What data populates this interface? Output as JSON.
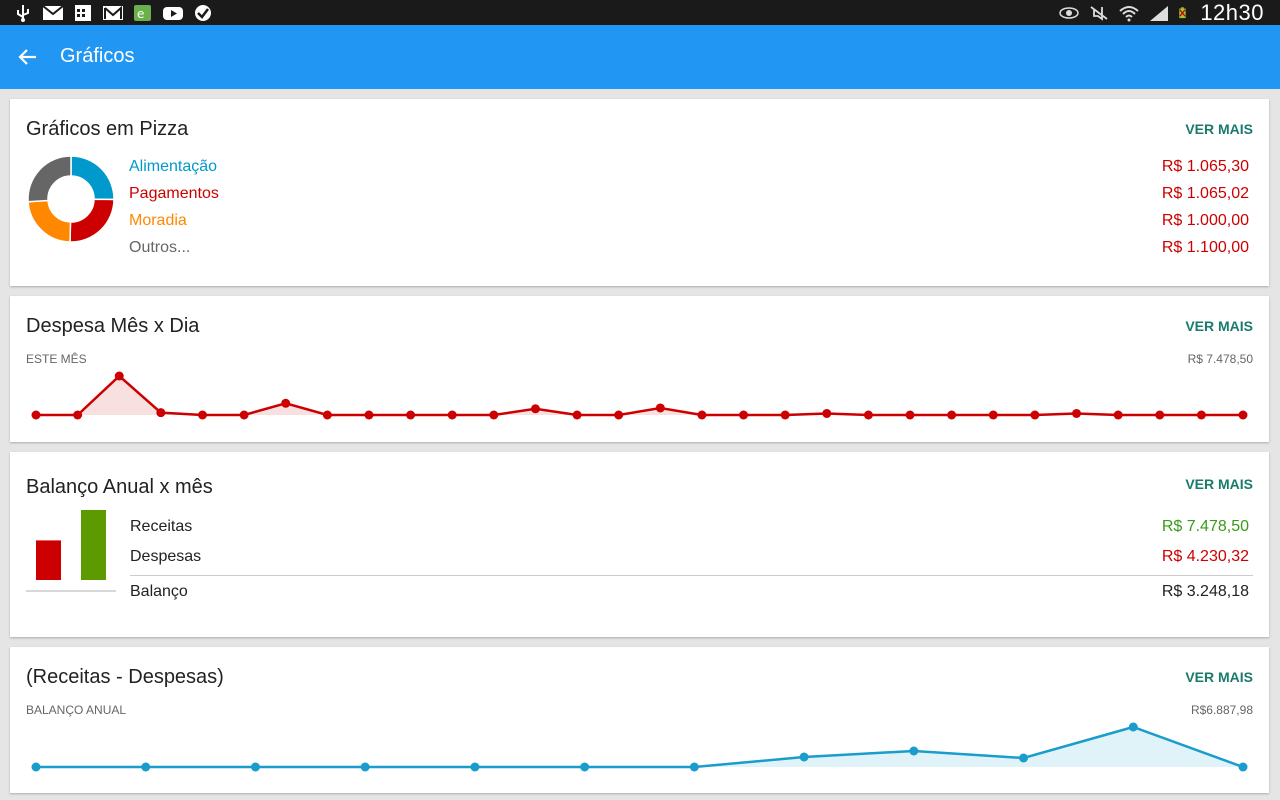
{
  "status_bar": {
    "time": "12h30",
    "left_icons": [
      "usb-icon",
      "mail-icon",
      "calendar-icon",
      "gmail-icon",
      "evernote-icon",
      "youtube-icon",
      "check-cloud-icon"
    ],
    "right_icons": [
      "eye-icon",
      "mute-icon",
      "wifi-icon",
      "signal-icon",
      "battery-icon"
    ]
  },
  "app_bar": {
    "title": "Gráficos"
  },
  "colors": {
    "primary": "#2196f3",
    "red": "#cc0000",
    "green": "#5c9a00",
    "blue": "#0099cc",
    "orange": "#ff8800",
    "gray": "#666666",
    "teal": "#1a7a6c"
  },
  "pie_card": {
    "title": "Gráficos em Pizza",
    "action": "VER MAIS",
    "items": [
      {
        "label": "Alimentação",
        "value": "R$ 1.065,30",
        "color": "#0099cc"
      },
      {
        "label": "Pagamentos",
        "value": "R$ 1.065,02",
        "color": "#cc0000"
      },
      {
        "label": "Moradia",
        "value": "R$ 1.000,00",
        "color": "#ff8800"
      },
      {
        "label": "Outros...",
        "value": "R$ 1.100,00",
        "color": "#666666"
      }
    ]
  },
  "daily_card": {
    "title": "Despesa Mês x Dia",
    "action": "VER MAIS",
    "period": "ESTE MÊS",
    "max_value": "R$ 7.478,50"
  },
  "balance_card": {
    "title": "Balanço Anual x mês",
    "action": "VER MAIS",
    "receitas_label": "Receitas",
    "receitas_value": "R$ 7.478,50",
    "despesas_label": "Despesas",
    "despesas_value": "R$ 4.230,32",
    "balanco_label": "Balanço",
    "balanco_value": "R$ 3.248,18"
  },
  "net_card": {
    "title": "(Receitas - Despesas)",
    "action": "VER MAIS",
    "period": "BALANÇO ANUAL",
    "max_value": "R$6.887,98"
  },
  "chart_data": [
    {
      "type": "pie",
      "categories": [
        "Alimentação",
        "Pagamentos",
        "Moradia",
        "Outros..."
      ],
      "values": [
        1065.3,
        1065.02,
        1000.0,
        1100.0
      ],
      "colors": [
        "#0099cc",
        "#cc0000",
        "#ff8800",
        "#666666"
      ]
    },
    {
      "type": "line",
      "x": [
        1,
        2,
        3,
        4,
        5,
        6,
        7,
        8,
        9,
        10,
        11,
        12,
        13,
        14,
        15,
        16,
        17,
        18,
        19,
        20,
        21,
        22,
        23,
        24,
        25,
        26,
        27,
        28,
        29,
        30
      ],
      "values": [
        0,
        0,
        1000,
        60,
        0,
        0,
        300,
        0,
        0,
        0,
        0,
        0,
        160,
        0,
        0,
        180,
        0,
        0,
        0,
        40,
        0,
        0,
        0,
        0,
        0,
        40,
        0,
        0,
        0,
        0
      ],
      "ylim": [
        0,
        1000
      ],
      "color": "#cc0000"
    },
    {
      "type": "bar",
      "categories": [
        "Despesas",
        "Receitas"
      ],
      "values": [
        4230.32,
        7478.5
      ],
      "colors": [
        "#cc0000",
        "#5c9a00"
      ]
    },
    {
      "type": "area",
      "x": [
        1,
        2,
        3,
        4,
        5,
        6,
        7,
        8,
        9,
        10,
        11,
        12
      ],
      "values": [
        0,
        0,
        0,
        0,
        0,
        0,
        0,
        1000,
        1600,
        900,
        4000,
        0
      ],
      "ylim": [
        0,
        4000
      ],
      "color": "#0099cc"
    }
  ]
}
